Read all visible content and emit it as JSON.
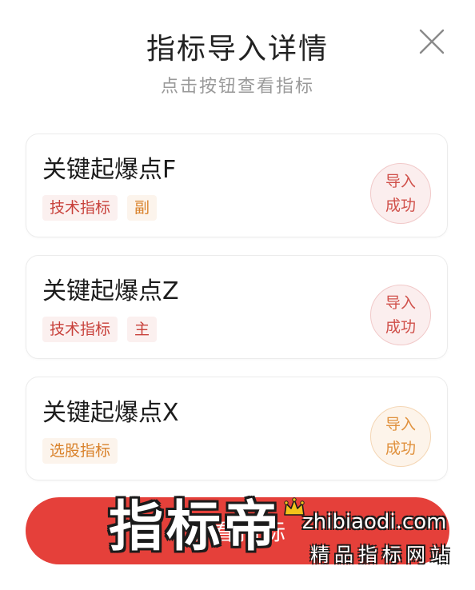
{
  "dialog": {
    "title": "指标导入详情",
    "subtitle": "点击按钮查看指标",
    "close_icon": "close-icon"
  },
  "cards": [
    {
      "name": "关键起爆点F",
      "tags": [
        {
          "label": "技术指标",
          "color": "#c8413b"
        },
        {
          "label": "副",
          "color": "#d9822b"
        }
      ],
      "status": {
        "line1": "导入",
        "line2": "成功",
        "color": "#d0504a"
      }
    },
    {
      "name": "关键起爆点Z",
      "tags": [
        {
          "label": "技术指标",
          "color": "#c8413b"
        },
        {
          "label": "主",
          "color": "#c8413b"
        }
      ],
      "status": {
        "line1": "导入",
        "line2": "成功",
        "color": "#d0504a"
      }
    },
    {
      "name": "关键起爆点X",
      "tags": [
        {
          "label": "选股指标",
          "color": "#d9822b"
        }
      ],
      "status": {
        "line1": "导入",
        "line2": "成功",
        "color": "#e0913d"
      }
    }
  ],
  "bottom_button": {
    "label": "查看指标",
    "color": "#e5403a"
  },
  "watermark": {
    "logo": "指标帝",
    "domain": "zhibiaodi.com",
    "slogan": "精品指标网站"
  }
}
